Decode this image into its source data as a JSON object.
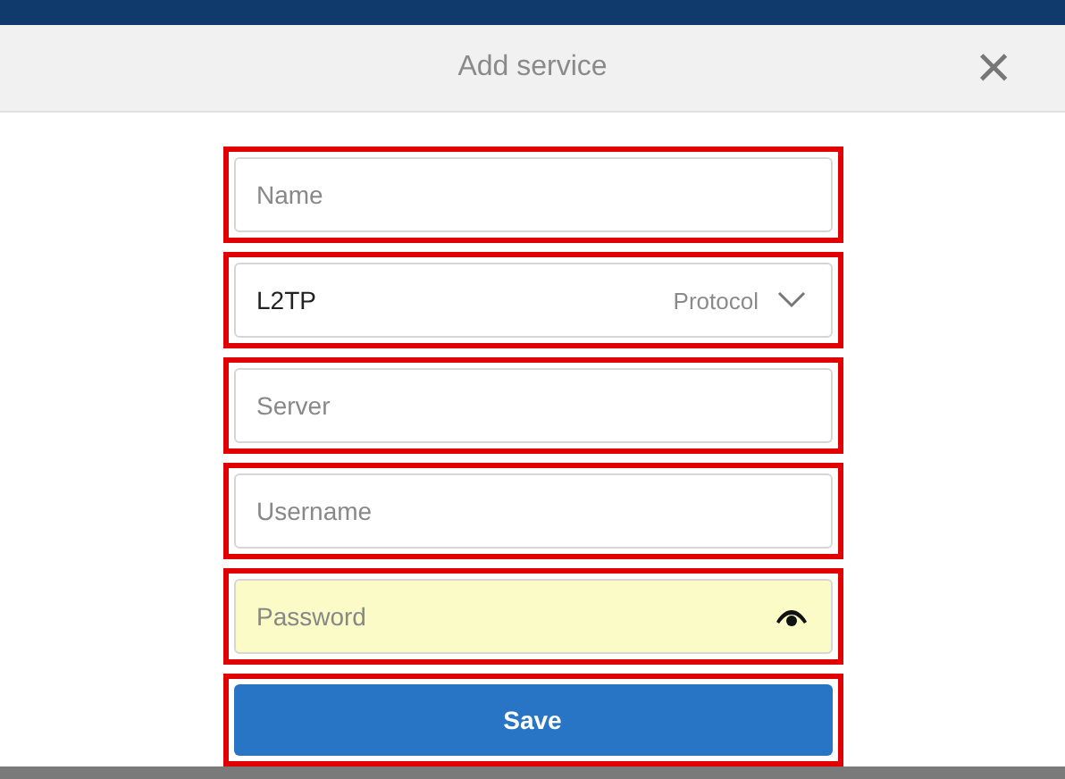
{
  "dialog": {
    "title": "Add service",
    "close": "×"
  },
  "fields": [
    {
      "kind": "text",
      "placeholder": "Name",
      "autofilled": false
    },
    {
      "kind": "select",
      "value": "L2TP",
      "hint": "Protocol"
    },
    {
      "kind": "text",
      "placeholder": "Server",
      "autofilled": false
    },
    {
      "kind": "text",
      "placeholder": "Username",
      "autofilled": false
    },
    {
      "kind": "password",
      "placeholder": "Password",
      "autofilled": true
    }
  ],
  "save_button": "Save"
}
